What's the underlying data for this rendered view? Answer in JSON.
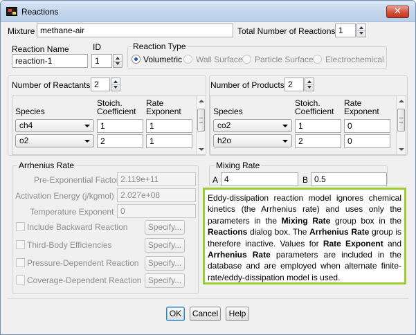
{
  "window": {
    "title": "Reactions",
    "close_label": "✕"
  },
  "mixture": {
    "label": "Mixture",
    "value": "methane-air"
  },
  "total_reactions": {
    "label": "Total Number of Reactions",
    "value": "1"
  },
  "reaction_name": {
    "label": "Reaction Name",
    "value": "reaction-1"
  },
  "id": {
    "label": "ID",
    "value": "1"
  },
  "reaction_type": {
    "title": "Reaction Type",
    "options": [
      "Volumetric",
      "Wall Surface",
      "Particle Surface",
      "Electrochemical"
    ],
    "selected": "Volumetric"
  },
  "reactants": {
    "count_label": "Number of Reactants",
    "count": "2",
    "col_species": "Species",
    "col_coeff": "Stoich.\nCoefficient",
    "col_coeff_1": "Stoich.",
    "col_coeff_2": "Coefficient",
    "col_rate_1": "Rate",
    "col_rate_2": "Exponent",
    "rows": [
      {
        "species": "ch4",
        "coeff": "1",
        "rate": "1"
      },
      {
        "species": "o2",
        "coeff": "2",
        "rate": "1"
      }
    ]
  },
  "products": {
    "count_label": "Number of Products",
    "count": "2",
    "col_species": "Species",
    "col_coeff_1": "Stoich.",
    "col_coeff_2": "Coefficient",
    "col_rate_1": "Rate",
    "col_rate_2": "Exponent",
    "rows": [
      {
        "species": "co2",
        "coeff": "1",
        "rate": "0"
      },
      {
        "species": "h2o",
        "coeff": "2",
        "rate": "0"
      }
    ]
  },
  "arrhenius": {
    "title": "Arrhenius Rate",
    "pre_exp_label": "Pre-Exponential Factor",
    "pre_exp_value": "2.119e+11",
    "activation_label": "Activation Energy (j/kgmol)",
    "activation_value": "2.027e+08",
    "temp_exp_label": "Temperature Exponent",
    "temp_exp_value": "0",
    "checks": [
      {
        "label": "Include Backward Reaction",
        "button": "Specify..."
      },
      {
        "label": "Third-Body Efficiencies",
        "button": "Specify..."
      },
      {
        "label": "Pressure-Dependent Reaction",
        "button": "Specify..."
      },
      {
        "label": "Coverage-Dependent Reaction",
        "button": "Specify..."
      }
    ]
  },
  "mixing_rate": {
    "title": "Mixing Rate",
    "a_label": "A",
    "a_value": "4",
    "b_label": "B",
    "b_value": "0.5"
  },
  "note": {
    "p1": "Eddy-dissipation reaction model ignores chemical kinetics (the Arrhenius rate) and uses only the parameters in the ",
    "b1": "Mixing Rate",
    "p2": " group box in the ",
    "b2": "Reactions",
    "p3": " dialog box. The ",
    "b3": "Arrhenius Rate",
    "p4": " group is therefore inactive. Values for ",
    "b4": "Rate Exponent",
    "p5": " and ",
    "b5": "Arrhenius Rate",
    "p6": " parameters are included in the database and are employed when alternate finite-rate/eddy-dissipation model is used.",
    "border_color": "#9acd32"
  },
  "buttons": {
    "ok": "OK",
    "cancel": "Cancel",
    "help": "Help"
  }
}
